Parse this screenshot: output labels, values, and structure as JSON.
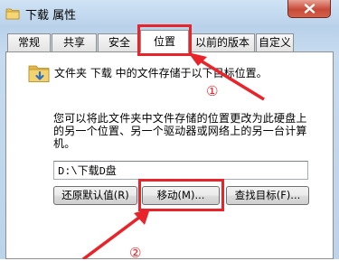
{
  "window": {
    "title": "下载 属性",
    "icon": "folder-icon"
  },
  "tabs": [
    {
      "label": "常规"
    },
    {
      "label": "共享"
    },
    {
      "label": "安全"
    },
    {
      "label": "位置",
      "active": true
    },
    {
      "label": "以前的版本"
    },
    {
      "label": "自定义"
    }
  ],
  "location": {
    "description": "文件夹 下载 中的文件存储于以下目标位置。",
    "info": "您可以将此文件夹中文件存储的位置更改为此硬盘上的另一个位置、另一个驱动器或网络上的另一台计算机。",
    "path_value": "D:\\下载D盘"
  },
  "buttons": {
    "restore": "还原默认值(R)",
    "move": "移动(M)...",
    "find": "查找目标(F)..."
  },
  "annotations": {
    "marker1": "①",
    "marker2": "②",
    "color": "#e8232a"
  }
}
